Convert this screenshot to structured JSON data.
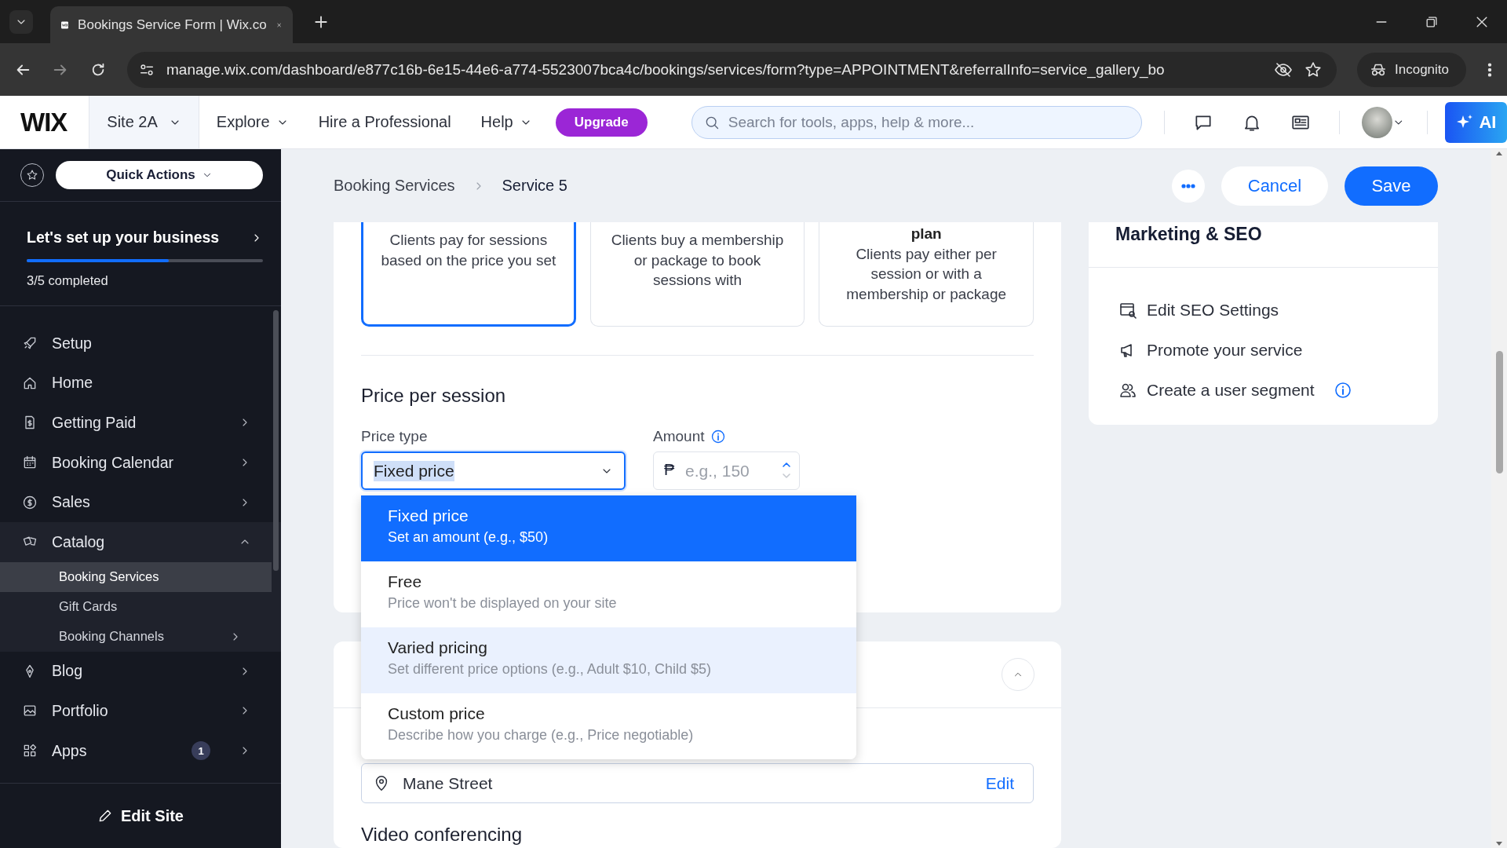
{
  "browser": {
    "tab_title": "Bookings Service Form | Wix.co",
    "url": "manage.wix.com/dashboard/e877c16b-6e15-44e6-a774-5523007bca4c/bookings/services/form?type=APPOINTMENT&referralInfo=service_gallery_bo",
    "incognito": "Incognito"
  },
  "topbar": {
    "logo": "WIX",
    "site": "Site 2A",
    "nav": [
      {
        "label": "Explore",
        "dropdown": true
      },
      {
        "label": "Hire a Professional",
        "dropdown": false
      },
      {
        "label": "Help",
        "dropdown": true
      }
    ],
    "upgrade": "Upgrade",
    "search": {
      "placeholder": "Search for tools, apps, help & more..."
    },
    "ai": "AI"
  },
  "sidebar": {
    "quick_actions": "Quick Actions",
    "setup": {
      "title": "Let's set up your business",
      "level": 0.6,
      "status": "3/5 completed"
    },
    "items": [
      {
        "label": "Setup",
        "submenu": false,
        "expanded": false
      },
      {
        "label": "Home",
        "submenu": false,
        "expanded": false
      },
      {
        "label": "Getting Paid",
        "submenu": true,
        "expanded": false
      },
      {
        "label": "Booking Calendar",
        "submenu": true,
        "expanded": false
      },
      {
        "label": "Sales",
        "submenu": true,
        "expanded": false
      },
      {
        "label": "Catalog",
        "submenu": true,
        "expanded": true,
        "children": [
          {
            "label": "Booking Services",
            "selected": true,
            "submenu": false
          },
          {
            "label": "Gift Cards",
            "selected": false,
            "submenu": false
          },
          {
            "label": "Booking Channels",
            "selected": false,
            "submenu": true
          }
        ]
      },
      {
        "label": "Blog",
        "submenu": true,
        "expanded": false
      },
      {
        "label": "Portfolio",
        "submenu": true,
        "expanded": false
      },
      {
        "label": "Apps",
        "submenu": true,
        "expanded": false,
        "badge": "1"
      }
    ],
    "edit_site": "Edit Site"
  },
  "header": {
    "breadcrumb": [
      "Booking Services",
      "Service 5"
    ],
    "cancel": "Cancel",
    "save": "Save"
  },
  "pricing_options": [
    {
      "description": "Clients pay for sessions based on the price you set",
      "selected": true
    },
    {
      "description": "Clients buy a membership or package to book sessions with",
      "selected": false
    },
    {
      "title": "plan",
      "description": "Clients pay either per session or with a membership or package",
      "selected": false
    }
  ],
  "price_section": {
    "heading": "Price per session",
    "price_type": {
      "label": "Price type",
      "value": "Fixed price"
    },
    "amount": {
      "label": "Amount",
      "currency": "₱",
      "placeholder": "e.g., 150"
    }
  },
  "price_dropdown": [
    {
      "title": "Fixed price",
      "description": "Set an amount (e.g., $50)",
      "selected": true,
      "hovered": false
    },
    {
      "title": "Free",
      "description": "Price won't be displayed on your site",
      "selected": false,
      "hovered": false
    },
    {
      "title": "Varied pricing",
      "description": "Set different price options (e.g., Adult $10, Child $5)",
      "selected": false,
      "hovered": true
    },
    {
      "title": "Custom price",
      "description": "Describe how you charge (e.g., Price negotiable)",
      "selected": false,
      "hovered": false
    }
  ],
  "location": {
    "address": "Mane Street",
    "edit": "Edit"
  },
  "next_section": "Video conferencing",
  "marketing": {
    "title": "Marketing & SEO",
    "links": [
      {
        "label": "Edit SEO Settings",
        "info": false
      },
      {
        "label": "Promote your service",
        "info": false
      },
      {
        "label": "Create a user segment",
        "info": true
      }
    ]
  }
}
